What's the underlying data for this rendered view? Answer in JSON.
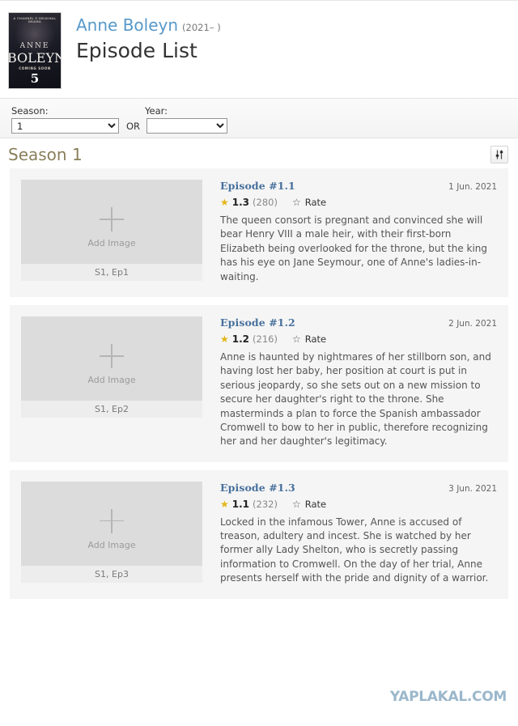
{
  "header": {
    "poster": {
      "top_tagline": "A CHANNEL 5 ORIGINAL DRAMA",
      "name_line1": "ANNE",
      "name_line2": "BOLEYN",
      "coming_soon": "Coming Soon",
      "channel": "5"
    },
    "show_title": "Anne Boleyn",
    "show_years": "(2021– )",
    "page_title": "Episode List"
  },
  "filters": {
    "season_label": "Season:",
    "season_value": "1",
    "season_options": [
      "1"
    ],
    "or_text": "OR",
    "year_label": "Year:",
    "year_value": "",
    "year_options": [
      ""
    ]
  },
  "season_section": {
    "heading": "Season 1",
    "sort_button_name": "sort-order-toggle"
  },
  "episodes": [
    {
      "placeholder": {
        "add_image_label": "Add Image",
        "caption": "S1, Ep1"
      },
      "title": "Episode #1.1",
      "air_date": "1 Jun. 2021",
      "rating": "1.3",
      "rating_count": "(280)",
      "rate_label": "Rate",
      "description": "The queen consort is pregnant and convinced she will bear Henry VIII a male heir, with their first-born Elizabeth being overlooked for the throne, but the king has his eye on Jane Seymour, one of Anne's ladies-in-waiting."
    },
    {
      "placeholder": {
        "add_image_label": "Add Image",
        "caption": "S1, Ep2"
      },
      "title": "Episode #1.2",
      "air_date": "2 Jun. 2021",
      "rating": "1.2",
      "rating_count": "(216)",
      "rate_label": "Rate",
      "description": "Anne is haunted by nightmares of her stillborn son, and having lost her baby, her position at court is put in serious jeopardy, so she sets out on a new mission to secure her daughter's right to the throne. She masterminds a plan to force the Spanish ambassador Cromwell to bow to her in public, therefore recognizing her and her daughter's legitimacy."
    },
    {
      "placeholder": {
        "add_image_label": "Add Image",
        "caption": "S1, Ep3"
      },
      "title": "Episode #1.3",
      "air_date": "3 Jun. 2021",
      "rating": "1.1",
      "rating_count": "(232)",
      "rate_label": "Rate",
      "description": "Locked in the infamous Tower, Anne is accused of treason, adultery and incest. She is watched by her former ally Lady Shelton, who is secretly passing information to Cromwell. On the day of her trial, Anne presents herself with the pride and dignity of a warrior."
    }
  ],
  "watermark": "YAPLAKAL.COM",
  "colors": {
    "link_blue": "#5799ca",
    "episode_link": "#47709c",
    "season_heading": "#8a7f5c",
    "star_gold": "#e2b616",
    "card_bg": "#f5f5f5",
    "placeholder_bg": "#dcdcdc",
    "watermark": "#9bb7cb"
  }
}
